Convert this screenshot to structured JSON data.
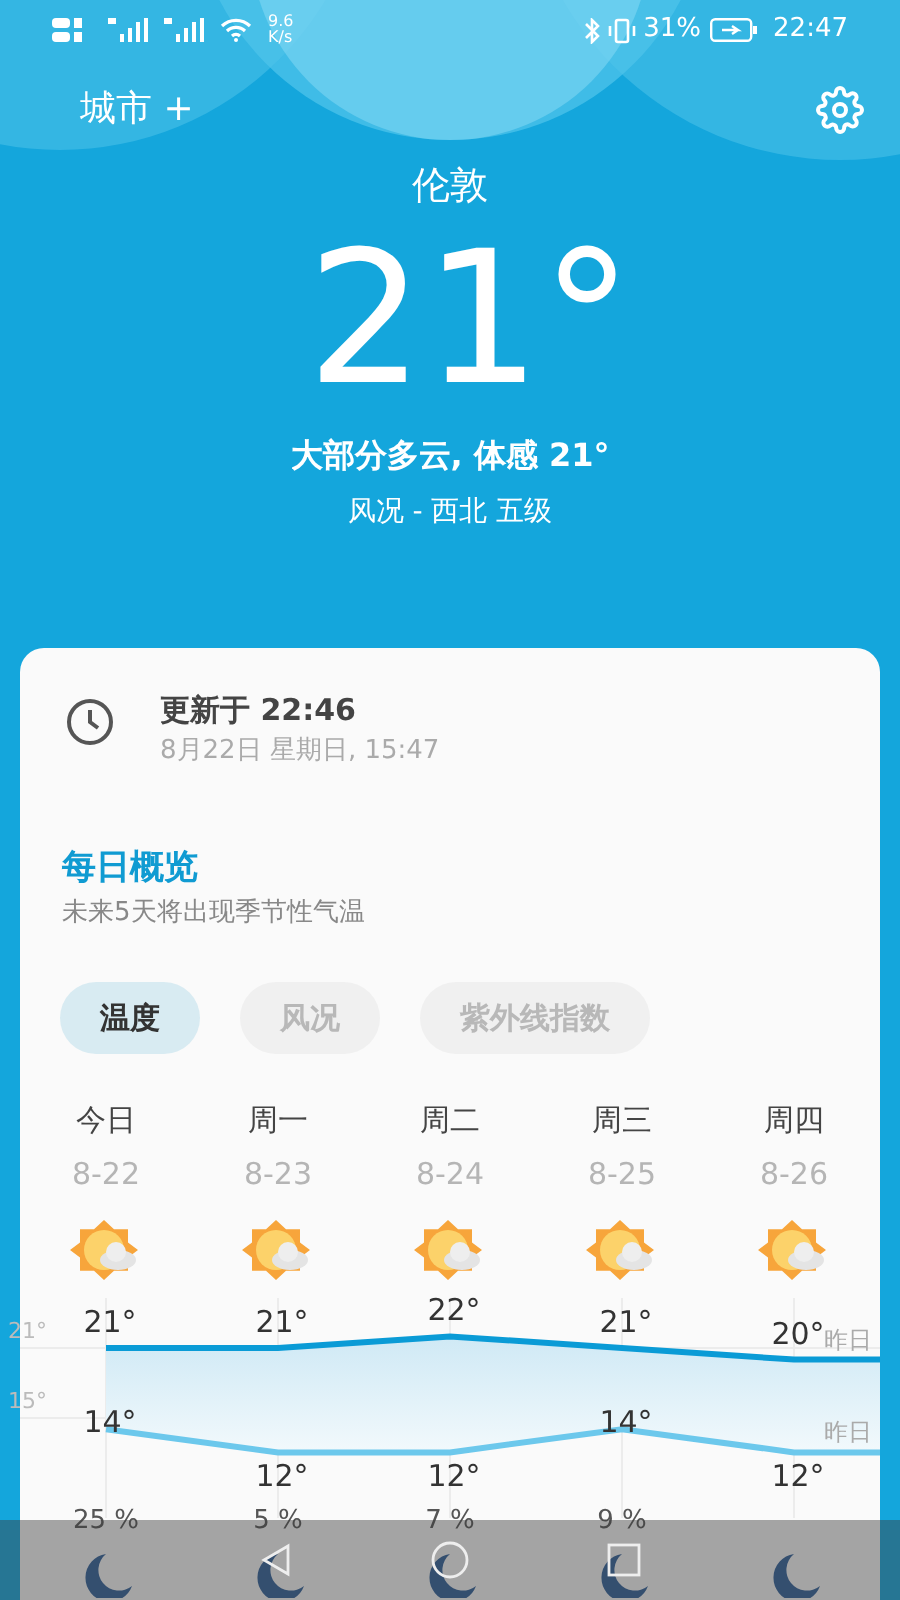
{
  "status_bar": {
    "speed": "9.6",
    "speed_unit": "K/s",
    "battery": "31%",
    "time": "22:47"
  },
  "header": {
    "cities": "城市 +"
  },
  "current": {
    "city": "伦敦",
    "temperature": "21°",
    "summary": "大部分多云, 体感 21°",
    "wind": "风况 - 西北 五级"
  },
  "update": {
    "title": "更新于 22:46",
    "subtitle": "8月22日 星期日, 15:47"
  },
  "overview": {
    "title": "每日概览",
    "subtitle": "未来5天将出现季节性气温"
  },
  "tabs": [
    {
      "label": "温度",
      "selected": true
    },
    {
      "label": "风况",
      "selected": false
    },
    {
      "label": "紫外线指数",
      "selected": false
    }
  ],
  "days": [
    {
      "name": "今日",
      "date": "8-22",
      "high": "21°",
      "low": "14°",
      "precip": "25 %"
    },
    {
      "name": "周一",
      "date": "8-23",
      "high": "21°",
      "low": "12°",
      "precip": "5 %"
    },
    {
      "name": "周二",
      "date": "8-24",
      "high": "22°",
      "low": "12°",
      "precip": "7 %"
    },
    {
      "name": "周三",
      "date": "8-25",
      "high": "21°",
      "low": "14°",
      "precip": "9 %"
    },
    {
      "name": "周四",
      "date": "8-26",
      "high": "20°",
      "low": "12°"
    }
  ],
  "graph": {
    "axis_labels": [
      "21°",
      "15°"
    ],
    "yesterday_labels": [
      "昨日",
      "昨日"
    ]
  }
}
